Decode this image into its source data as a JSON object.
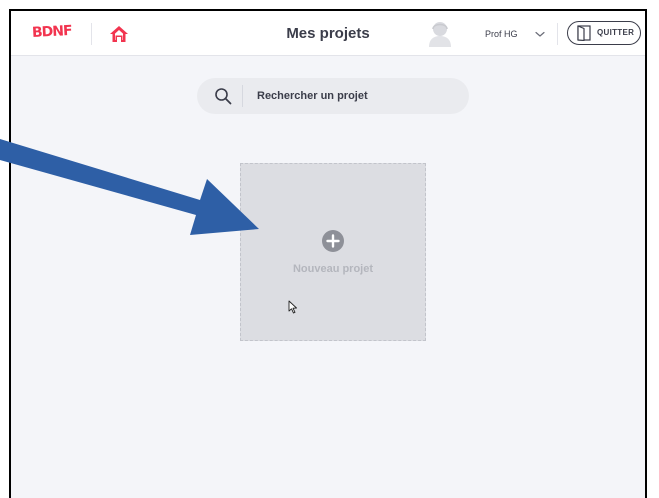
{
  "app": {
    "logo_text": "BDNF",
    "page_title": "Mes projets"
  },
  "user": {
    "name": "Prof HG"
  },
  "header": {
    "quit_label": "QUITTER"
  },
  "search": {
    "placeholder": "Rechercher un projet",
    "value": ""
  },
  "projects": {
    "new_project_label": "Nouveau projet"
  },
  "icons": {
    "home": "home-icon",
    "avatar": "user-avatar-icon",
    "chevron": "chevron-down-icon",
    "quit": "door-exit-icon",
    "search": "search-icon",
    "plus": "plus-circle-icon",
    "cursor": "mouse-pointer-icon"
  },
  "colors": {
    "brand": "#f2344f",
    "text": "#3b3d4a",
    "background": "#f4f5f9",
    "card": "#dcdde2",
    "annotation_arrow": "#2e5fa6"
  }
}
